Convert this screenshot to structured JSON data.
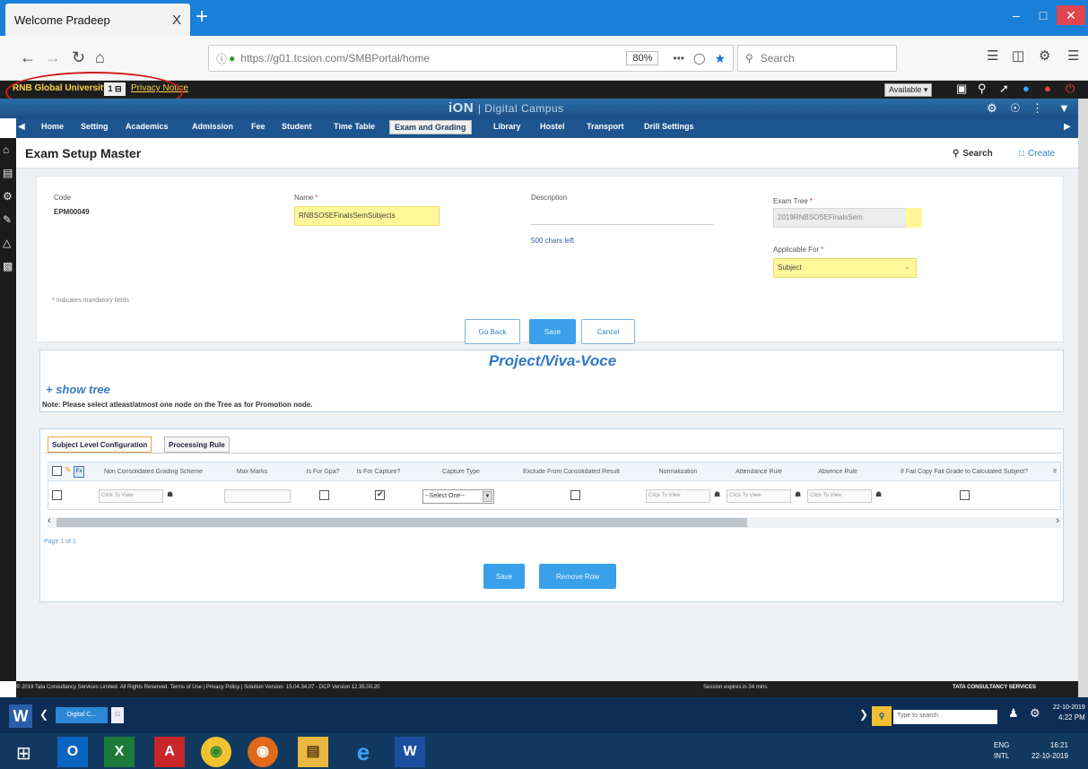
{
  "browser": {
    "tab_title": "Welcome Pradeep",
    "tab_close": "X",
    "new_tab": "+",
    "url": "https://g01.tcsion.com/SMBPortal/home",
    "zoom": "80%",
    "dots": "•••",
    "search_placeholder": "Search"
  },
  "appbar": {
    "university": "RNB Global University",
    "user_badge": "1 ⊟",
    "privacy": "Privacy Notice",
    "availability": "Available ▾"
  },
  "brand": {
    "name": "iON",
    "subtitle": "| Digital Campus"
  },
  "menu": {
    "items": [
      "Home",
      "Setting",
      "Academics",
      "Admission",
      "Fee",
      "Student",
      "Time Table",
      "Exam and Grading",
      "Library",
      "Hostel",
      "Transport",
      "Drill Settings"
    ],
    "active": "Exam and Grading"
  },
  "page": {
    "title": "Exam Setup Master",
    "search_label": "Search",
    "create_label": "Create"
  },
  "form": {
    "code_label": "Code",
    "code_value": "EPM00049",
    "name_label": "Name",
    "name_value": "RNBSOSEFinalsSemSubjects",
    "description_label": "Description",
    "chars_left": "500 chars left",
    "exam_tree_label": "Exam Tree",
    "exam_tree_value": "2019RNBSOSEFinalsSem",
    "applicable_label": "Applicable For",
    "applicable_value": "Subject",
    "mandatory_note": "Indicates mandatory fields",
    "req_mark": "*",
    "btn_goback": "Go Back",
    "btn_save": "Save",
    "btn_cancel": "Cancel"
  },
  "tree": {
    "title": "Project/Viva-Voce",
    "show_tree": "+ show tree",
    "note": "Note: Please select atleast/atmost one node on the Tree as for Promotion node."
  },
  "grid": {
    "tab_subject": "Subject Level Configuration",
    "tab_processing": "Processing Rule",
    "fx": "Fx",
    "headers": [
      "Non Consolidated Grading Scheme",
      "Max Marks",
      "Is For Gpa?",
      "Is For Capture?",
      "Capture Type",
      "Exclude From Consolidated Result",
      "Normalization",
      "Attendance Rule",
      "Absence Rule",
      "If Fail Copy Fail Grade to Calculated Subject?",
      "If"
    ],
    "cell_placeholder": "Click To View",
    "select_value": "--Select One--",
    "page_info": "Page 1 of 1",
    "btn_save": "Save",
    "btn_remove": "Remove Row"
  },
  "footer": {
    "left": "© 2019 Tata Consultancy Services Limited. All Rights Reserved.   Terms of Use | Privacy Policy | Solution Version: 15.04.34.07 - DCP Version 12.35.00.20",
    "middle": "Session expires in 34 mins",
    "right": "TATA CONSULTANCY SERVICES"
  },
  "taskbar": {
    "app_label": "Digital C...",
    "search": "Type to search",
    "time": "4:22 PM",
    "date": "22-10-2019",
    "lang": "ENG",
    "lang_sub": "INTL",
    "time2": "16:21",
    "date2": "22-10-2019"
  }
}
